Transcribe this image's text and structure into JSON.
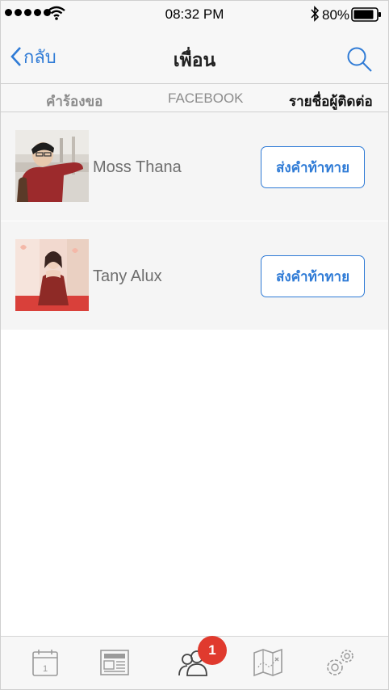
{
  "status_bar": {
    "time": "08:32 PM",
    "battery_percent": "80%",
    "signal_dots": 5,
    "icons": [
      "signal-dots-icon",
      "wifi-icon",
      "bluetooth-icon",
      "battery-icon"
    ]
  },
  "navbar": {
    "back_label": "กลับ",
    "title": "เพื่อน",
    "search_icon": "search-icon"
  },
  "tabs": [
    {
      "label": "คำร้องขอ",
      "selected": false
    },
    {
      "label": "FACEBOOK",
      "selected": false
    },
    {
      "label": "รายชื่อผู้ติดต่อ",
      "selected": true
    }
  ],
  "contacts": [
    {
      "name": "Moss Thana",
      "button_label": "ส่งคำท้าทาย"
    },
    {
      "name": "Tany Alux",
      "button_label": "ส่งคำท้าทาย"
    }
  ],
  "tabbar": {
    "items": [
      "calendar-icon",
      "news-icon",
      "friends-icon",
      "map-icon",
      "settings-icon"
    ],
    "badge_count": "1"
  },
  "colors": {
    "accent": "#2f7bd6",
    "badge": "#e03a2e",
    "bar_background": "#f7f7f7"
  }
}
